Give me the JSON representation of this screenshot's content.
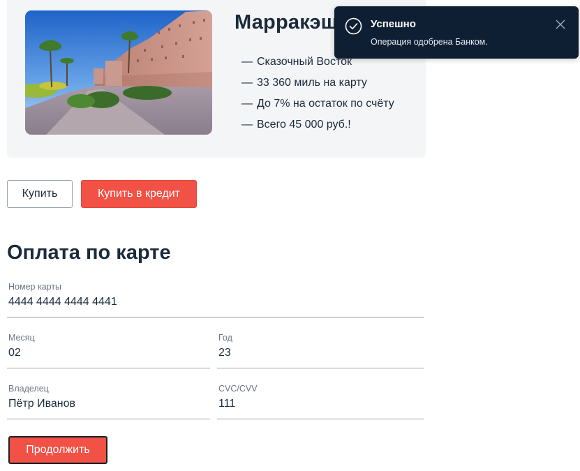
{
  "product": {
    "title": "Марракэш",
    "image_icon": "marrakesh-photo",
    "features": [
      "Сказочный Восток",
      "33 360 миль на карту",
      "До 7% на остаток по счёту",
      "Всего 45 000 руб.!"
    ],
    "feature_bullet": "—"
  },
  "actions": {
    "buy_label": "Купить",
    "credit_label": "Купить в кредит"
  },
  "payment": {
    "title": "Оплата по карте",
    "card_number": {
      "label": "Номер карты",
      "value": "4444 4444 4444 4441"
    },
    "month": {
      "label": "Месяц",
      "value": "02"
    },
    "year": {
      "label": "Год",
      "value": "23"
    },
    "owner": {
      "label": "Владелец",
      "value": "Пётр Иванов"
    },
    "cvc": {
      "label": "CVC/CVV",
      "value": "111"
    },
    "continue_label": "Продолжить"
  },
  "notification": {
    "title": "Успешно",
    "message": "Операция одобрена Банком.",
    "icon": "check-circle-icon",
    "close_icon": "close-icon"
  },
  "colors": {
    "accent": "#f25146",
    "toast_bg": "#0f1f33",
    "card_bg": "#f4f5f7",
    "text": "#1b2a3c"
  }
}
